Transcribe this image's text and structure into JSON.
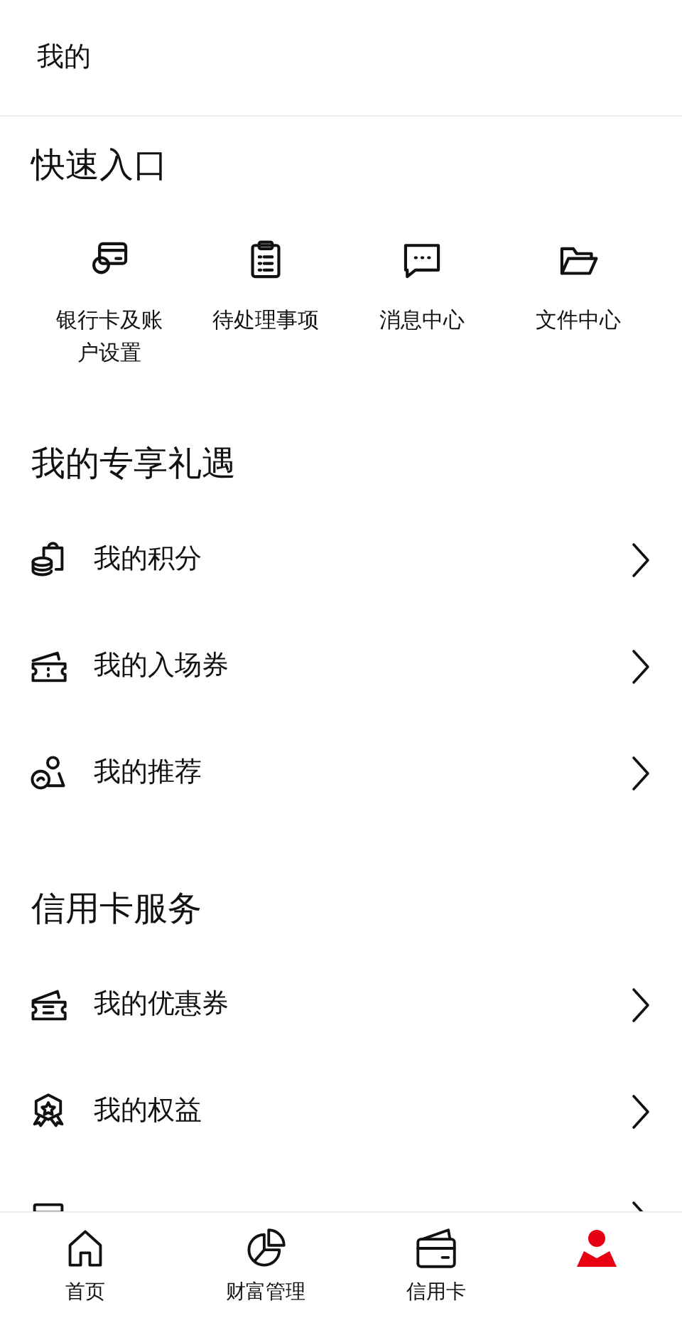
{
  "header": {
    "title": "我的"
  },
  "quick_access": {
    "title": "快速入口",
    "items": [
      {
        "kind": "card",
        "label": "银行卡及账户设置"
      },
      {
        "kind": "clipboard",
        "label": "待处理事项"
      },
      {
        "kind": "message",
        "label": "消息中心"
      },
      {
        "kind": "folder",
        "label": "文件中心"
      }
    ]
  },
  "sections": [
    {
      "title": "我的专享礼遇",
      "items": [
        {
          "kind": "points",
          "label": "我的积分"
        },
        {
          "kind": "ticket",
          "label": "我的入场券"
        },
        {
          "kind": "referral",
          "label": "我的推荐"
        }
      ]
    },
    {
      "title": "信用卡服务",
      "items": [
        {
          "kind": "coupon",
          "label": "我的优惠券"
        },
        {
          "kind": "badge",
          "label": "我的权益"
        },
        {
          "kind": "calendar"
        }
      ]
    }
  ],
  "tab_bar": [
    {
      "kind": "home",
      "label": "首页",
      "selected": false
    },
    {
      "kind": "chart",
      "label": "财富管理",
      "selected": false
    },
    {
      "kind": "wallet",
      "label": "信用卡",
      "selected": false
    },
    {
      "kind": "person",
      "selected": true
    }
  ]
}
